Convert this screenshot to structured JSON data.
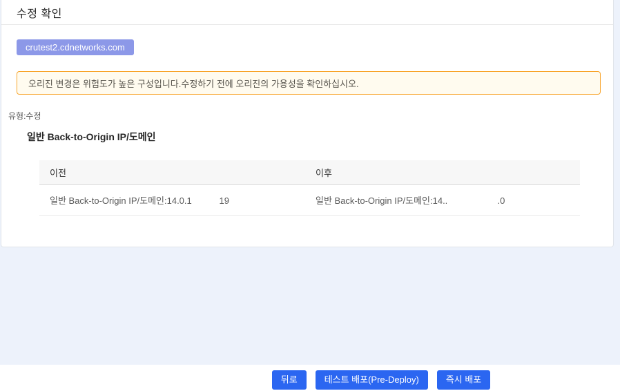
{
  "card": {
    "title": "수정 확인"
  },
  "domain_chip": {
    "label": "crutest2.cdnetworks.com"
  },
  "warning": {
    "message": "오리진 변경은 위험도가 높은 구성입니다.수정하기 전에 오리진의 가용성을 확인하십시오."
  },
  "change": {
    "type_line": "유형:수정",
    "section_title": "일반 Back-to-Origin IP/도메인"
  },
  "diff_table": {
    "columns": [
      "이전",
      "이후"
    ],
    "rows": [
      {
        "before": "일반 Back-to-Origin IP/도메인:14.0.1           19",
        "after": "일반 Back-to-Origin IP/도메인:14..                    .0"
      }
    ]
  },
  "footer": {
    "back_label": "뒤로",
    "pre_deploy_label": "테스트 배포(Pre-Deploy)",
    "deploy_label": "즉시 배포"
  },
  "colors": {
    "page_background": "#edf2fb",
    "chip_background": "#8c98e8",
    "warning_border": "#f8a42a",
    "warning_background": "#fffbef",
    "button_blue": "#2b66f1"
  }
}
